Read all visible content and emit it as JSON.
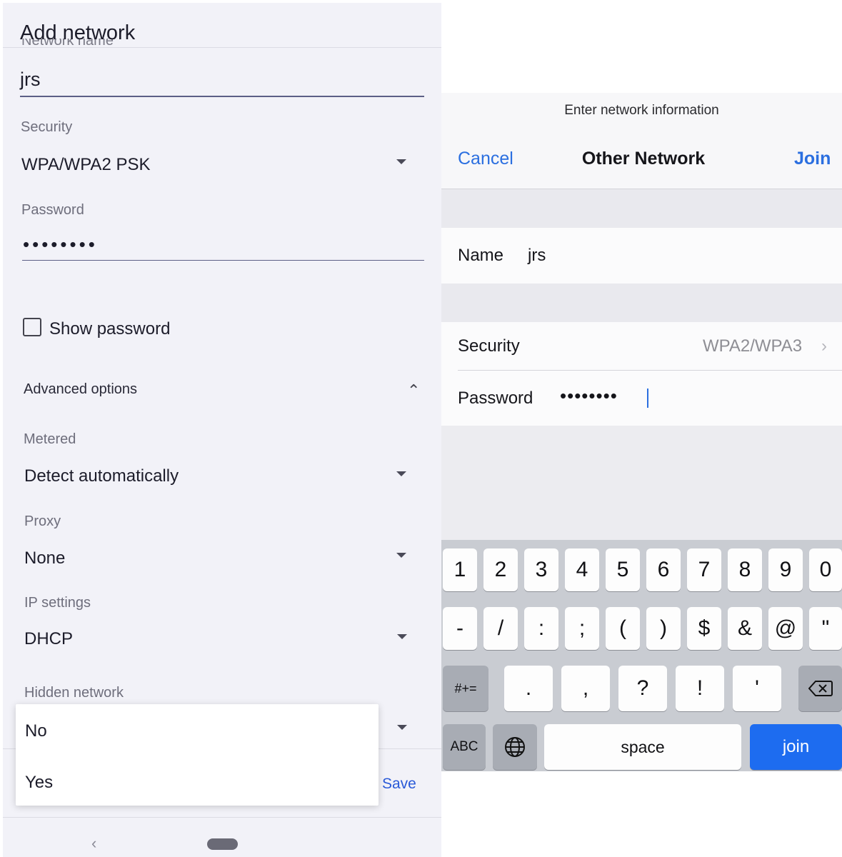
{
  "android": {
    "title": "Add network",
    "network_name_label": "Network name",
    "network_name_value": "jrs",
    "security_label": "Security",
    "security_value": "WPA/WPA2 PSK",
    "password_label": "Password",
    "password_masked": "••••••••",
    "show_password": "Show password",
    "advanced_options": "Advanced options",
    "metered_label": "Metered",
    "metered_value": "Detect automatically",
    "proxy_label": "Proxy",
    "proxy_value": "None",
    "ip_label": "IP settings",
    "ip_value": "DHCP",
    "hidden_label": "Hidden network",
    "hidden_options": [
      "No",
      "Yes"
    ],
    "save": "Save",
    "icons": {
      "dropdown": "caret-down-icon",
      "collapse": "chevron-up-icon",
      "back": "back-nav-icon",
      "home": "home-pill-icon"
    }
  },
  "ios": {
    "prompt": "Enter network information",
    "cancel": "Cancel",
    "title": "Other Network",
    "join": "Join",
    "name_label": "Name",
    "name_value": "jrs",
    "security_label": "Security",
    "security_value": "WPA2/WPA3",
    "password_label": "Password",
    "password_masked": "••••••••",
    "accent": "#2b6fe0",
    "keyboard": {
      "row1": [
        "1",
        "2",
        "3",
        "4",
        "5",
        "6",
        "7",
        "8",
        "9",
        "0"
      ],
      "row2": [
        "-",
        "/",
        ":",
        ";",
        "(",
        ")",
        "$",
        "&",
        "@",
        "\""
      ],
      "row3_mode": "#+=",
      "row3": [
        ".",
        ",",
        "?",
        "!",
        "'"
      ],
      "abc": "ABC",
      "space": "space",
      "join": "join",
      "icons": {
        "delete": "delete-icon",
        "globe": "globe-icon"
      }
    }
  }
}
